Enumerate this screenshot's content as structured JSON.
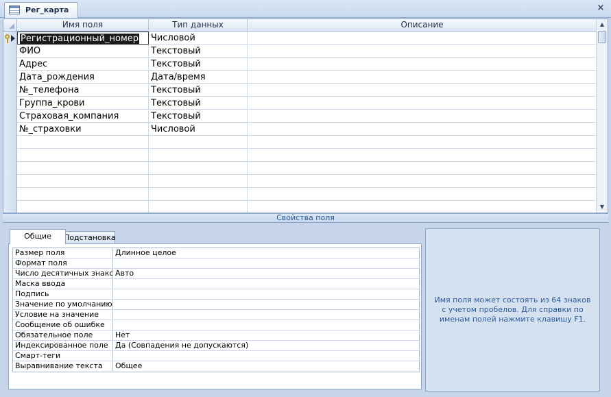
{
  "tab": {
    "title": "Рег_карта",
    "icon": "table-icon",
    "close": "×"
  },
  "grid": {
    "columns": [
      "Имя поля",
      "Тип данных",
      "Описание"
    ],
    "rows": [
      {
        "name": "Регистрационный_номер",
        "type": "Числовой",
        "description": ""
      },
      {
        "name": "ФИО",
        "type": "Текстовый",
        "description": ""
      },
      {
        "name": "Адрес",
        "type": "Текстовый",
        "description": ""
      },
      {
        "name": "Дата_рождения",
        "type": "Дата/время",
        "description": ""
      },
      {
        "name": "№_телефона",
        "type": "Текстовый",
        "description": ""
      },
      {
        "name": "Группа_крови",
        "type": "Текстовый",
        "description": ""
      },
      {
        "name": "Страховая_компания",
        "type": "Текстовый",
        "description": ""
      },
      {
        "name": "№_страховки",
        "type": "Числовой",
        "description": ""
      }
    ]
  },
  "properties": {
    "band_title": "Свойства поля",
    "tabs": [
      "Общие",
      "Подстановка"
    ],
    "items": [
      {
        "label": "Размер поля",
        "value": "Длинное целое"
      },
      {
        "label": "Формат поля",
        "value": ""
      },
      {
        "label": "Число десятичных знаков",
        "value": "Авто"
      },
      {
        "label": "Маска ввода",
        "value": ""
      },
      {
        "label": "Подпись",
        "value": ""
      },
      {
        "label": "Значение по умолчанию",
        "value": ""
      },
      {
        "label": "Условие на значение",
        "value": ""
      },
      {
        "label": "Сообщение об ошибке",
        "value": ""
      },
      {
        "label": "Обязательное поле",
        "value": "Нет"
      },
      {
        "label": "Индексированное поле",
        "value": "Да (Совпадения не допускаются)"
      },
      {
        "label": "Смарт-теги",
        "value": ""
      },
      {
        "label": "Выравнивание текста",
        "value": "Общее"
      }
    ],
    "help_text": "Имя поля может состоять из 64 знаков с учетом пробелов.  Для справки по именам полей нажмите клавишу F1."
  }
}
